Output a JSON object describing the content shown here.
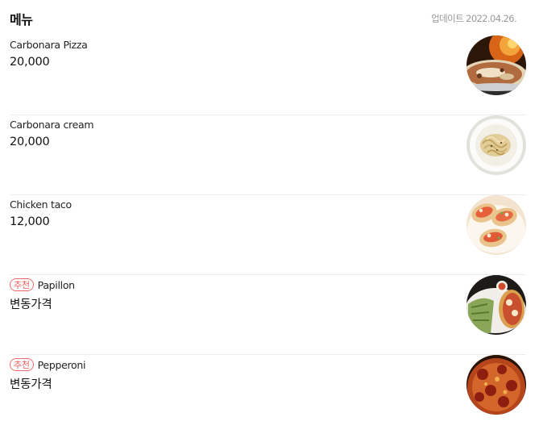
{
  "header": {
    "title": "메뉴",
    "updated": "업데이트 2022.04.26."
  },
  "items": [
    {
      "name": "Carbonara Pizza",
      "price": "20,000",
      "badge": "",
      "image_icon": "pizza-photo-icon"
    },
    {
      "name": "Carbonara cream",
      "price": "20,000",
      "badge": "",
      "image_icon": "pasta-photo-icon"
    },
    {
      "name": "Chicken taco",
      "price": "12,000",
      "badge": "",
      "image_icon": "taco-photo-icon"
    },
    {
      "name": "Papillon",
      "price": "변동가격",
      "badge": "추천",
      "image_icon": "papillon-photo-icon"
    },
    {
      "name": "Pepperoni",
      "price": "변동가격",
      "badge": "추천",
      "image_icon": "pepperoni-photo-icon"
    }
  ],
  "colors": {
    "badge": "#ef5a5a",
    "divider": "#ececec",
    "muted_text": "#999999"
  }
}
